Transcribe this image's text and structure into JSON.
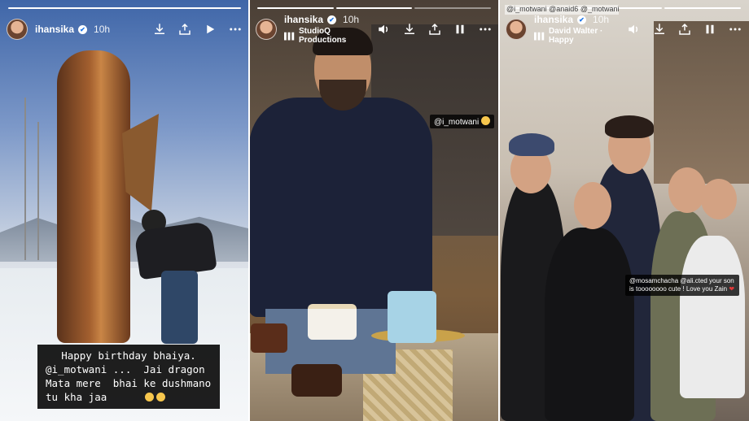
{
  "stories": [
    {
      "username": "ihansika",
      "time": "10h",
      "subtitle": "",
      "progress_segments": [
        1,
        0,
        0
      ],
      "caption_lines": [
        "Happy birthday bhaiya.",
        "@i_motwani ...  Jai dragon",
        "Mata mere  bhai ke dushmano",
        "tu kha jaa"
      ],
      "controls": [
        "download-icon",
        "share-icon",
        "play-icon",
        "more-icon"
      ]
    },
    {
      "username": "ihansika",
      "time": "10h",
      "subtitle": "StudioQ Productions",
      "progress_segments": [
        1,
        1,
        0
      ],
      "tag": "@i_motwani",
      "controls": [
        "volume-icon",
        "download-icon",
        "share-icon",
        "pause-icon",
        "more-icon"
      ]
    },
    {
      "username": "ihansika",
      "time": "10h",
      "subtitle": "David Walter · Happy",
      "progress_segments": [
        1,
        1,
        1
      ],
      "top_mentions": "@i_motwani @anaid6 @_motwani",
      "tag": "@mosamchacha @ali.cted  your  son is toooooooo cute ! Love you Zain",
      "controls": [
        "volume-icon",
        "download-icon",
        "share-icon",
        "pause-icon",
        "more-icon"
      ]
    }
  ],
  "colors": {
    "verified": "#1a73e8",
    "caption_bg": "#000000",
    "heart": "#e23b3b"
  }
}
